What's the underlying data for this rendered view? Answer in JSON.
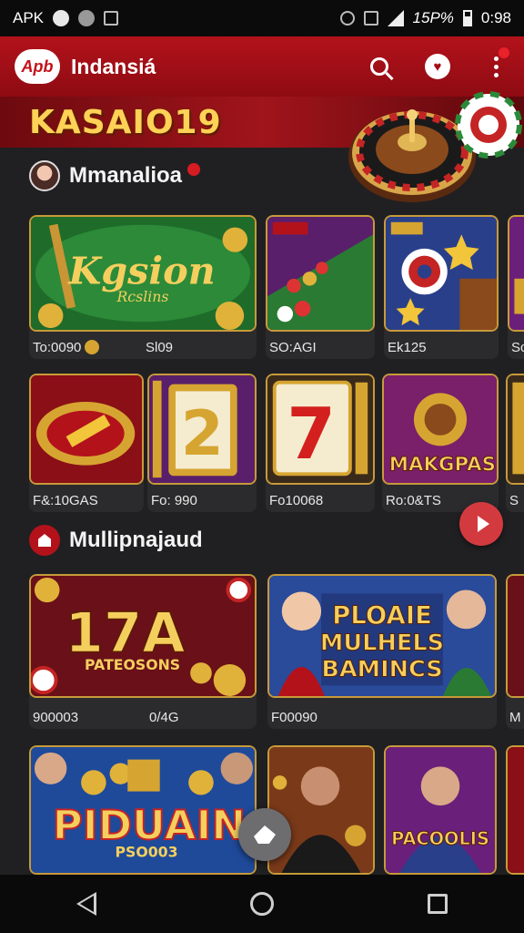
{
  "status_bar": {
    "left_text": "APK",
    "battery": "15P%",
    "time": "0:98"
  },
  "app_bar": {
    "logo_text": "Apb",
    "title": "Indansiá"
  },
  "banner": {
    "title": "KASAIO19"
  },
  "section1": {
    "title": "Mmanalioa",
    "row1": [
      {
        "art_title": "Kgsion",
        "art_sub": "Rcslins",
        "caption_a": "To:0090",
        "caption_b": "Sl09"
      },
      {
        "art_title": "",
        "art_sub": "",
        "caption_a": "SO:AGI",
        "caption_b": ""
      },
      {
        "art_title": "",
        "art_sub": "",
        "caption_a": "Ek125",
        "caption_b": ""
      },
      {
        "art_title": "",
        "art_sub": "",
        "caption_a": "Sc",
        "caption_b": ""
      }
    ],
    "row2": [
      {
        "caption_a": "F&:10GAS",
        "caption_b": ""
      },
      {
        "caption_a": "Fo: 990",
        "caption_b": ""
      },
      {
        "caption_a": "Fo10068",
        "caption_b": ""
      },
      {
        "art_title": "MAKGPAS",
        "caption_a": "Ro:0&TS",
        "caption_b": ""
      },
      {
        "caption_a": "S",
        "caption_b": ""
      }
    ]
  },
  "section2": {
    "title": "Mullipnajaud",
    "row1": [
      {
        "art_title": "17A",
        "art_sub": "PATEOSONS",
        "caption_a": "900003",
        "caption_b": "0/4G"
      },
      {
        "art_title": "PLOAIE MULHELS BAMINCS",
        "caption_a": "F00090",
        "caption_b": ""
      },
      {
        "caption_a": "M",
        "caption_b": ""
      }
    ],
    "row2": [
      {
        "art_title": "PIDUAIN",
        "art_sub": "PSO003"
      },
      {
        "art_title": ""
      },
      {
        "art_title": "PACOOLIS"
      }
    ]
  },
  "icons": {
    "search": "search-icon",
    "profile": "profile-icon",
    "menu": "more-vert-icon",
    "play": "play-icon",
    "edit": "edit-icon",
    "nav_back": "back-icon",
    "nav_home": "home-icon",
    "nav_recent": "recents-icon"
  },
  "colors": {
    "app_bar": "#b3121b",
    "accent_gold": "#ffd257",
    "background": "#202022"
  }
}
